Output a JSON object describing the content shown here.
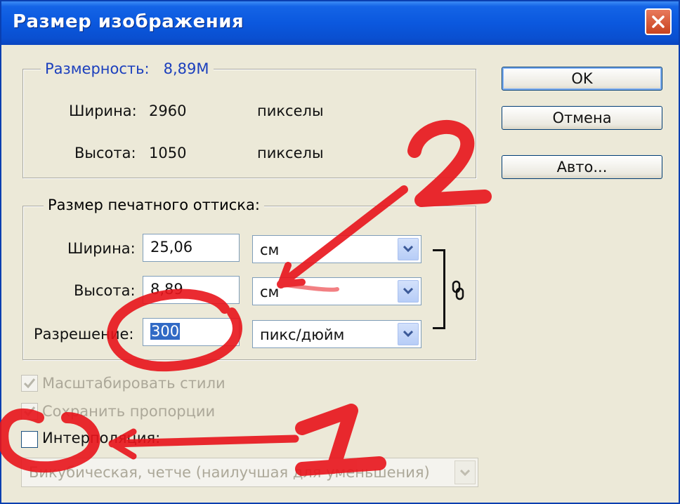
{
  "window": {
    "title": "Размер изображения"
  },
  "pixel_dimensions": {
    "label": "Размерность:",
    "value": "8,89M",
    "width_label": "Ширина:",
    "width_value": "2960",
    "width_unit": "пикселы",
    "height_label": "Высота:",
    "height_value": "1050",
    "height_unit": "пикселы"
  },
  "document_size": {
    "label": "Размер печатного оттиска:",
    "width_label": "Ширина:",
    "width_value": "25,06",
    "width_unit": "см",
    "height_label": "Высота:",
    "height_value": "8,89",
    "height_unit": "см",
    "resolution_label": "Разрешение:",
    "resolution_value": "300",
    "resolution_unit": "пикс/дюйм"
  },
  "buttons": {
    "ok": "OK",
    "cancel": "Отмена",
    "auto": "Авто..."
  },
  "options": {
    "scale_styles": "Масштабировать стили",
    "constrain": "Сохранить пропорции",
    "resample": "Интерполяция:",
    "resample_method": "Бикубическая, четче (наилучшая для уменьшения)"
  },
  "annotations": {
    "arrow_1": "1",
    "arrow_2": "2"
  },
  "colors": {
    "title_bar": "#0b58de",
    "annotation": "#e8141b",
    "label_blue": "#1b3fbd",
    "selection": "#316ac5"
  }
}
